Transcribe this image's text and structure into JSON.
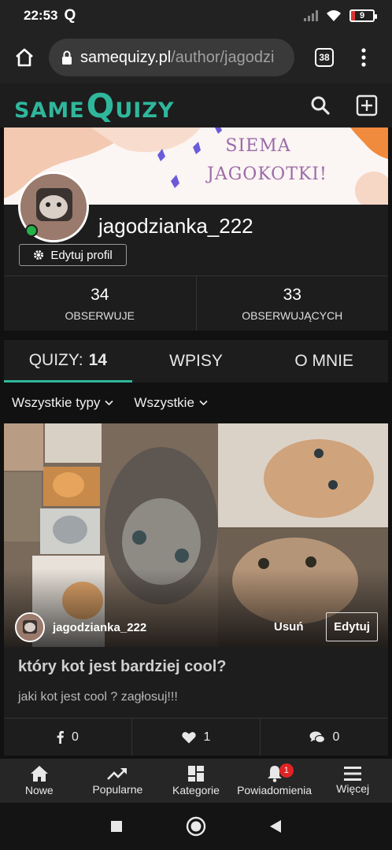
{
  "status_bar": {
    "time": "22:53",
    "battery": "9"
  },
  "browser": {
    "url_host": "samequizy.pl",
    "url_path": "/author/jagodzi",
    "tab_count": "38"
  },
  "app": {
    "logo_small_1": "SAME",
    "logo_big": "Q",
    "logo_small_2": "UIZY"
  },
  "banner": {
    "line1": "SIEMA",
    "line2": "JAGOKOTKI!"
  },
  "profile": {
    "username": "jagodzianka_222",
    "edit_label": "Edytuj profil"
  },
  "stats": {
    "following_count": "34",
    "following_label": "OBSERWUJE",
    "followers_count": "33",
    "followers_label": "OBSERWUJĄCYCH"
  },
  "tabs": {
    "quizzes_label": "QUIZY:",
    "quizzes_count": "14",
    "posts_label": "WPISY",
    "about_label": "O MNIE"
  },
  "filters": {
    "type_label": "Wszystkie typy",
    "scope_label": "Wszystkie"
  },
  "quiz_card": {
    "author": "jagodzianka_222",
    "delete_label": "Usuń",
    "edit_label": "Edytuj",
    "title": "który kot jest bardziej cool?",
    "description": "jaki kot jest cool ? zagłosuj!!!",
    "shares": "0",
    "likes": "1",
    "comments": "0"
  },
  "bottom_nav": {
    "new_label": "Nowe",
    "popular_label": "Popularne",
    "categories_label": "Kategorie",
    "notifications_label": "Powiadomienia",
    "notifications_badge": "1",
    "more_label": "Więcej"
  },
  "colors": {
    "brand": "#2fb79c",
    "background": "#111111",
    "surface": "#1d1d1d",
    "badge": "#e02424"
  }
}
